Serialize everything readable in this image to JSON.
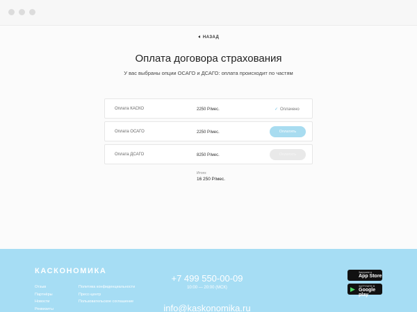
{
  "nav": {
    "back_label": "НАЗАД"
  },
  "header": {
    "title": "Оплата договора страхования",
    "subtitle": "У вас выбраны опции ОСАГО и ДСАГО: оплата происходит по частям"
  },
  "payments": [
    {
      "name": "Оплата КАСКО",
      "price": "2250 Р/мес.",
      "status": "Оплачено"
    },
    {
      "name": "Оплата ОСАГО",
      "price": "2250 Р/мес.",
      "button": "Оплатить"
    },
    {
      "name": "Оплата ДСАГО",
      "price": "8250 Р/мес.",
      "button": "Оплатить"
    }
  ],
  "total": {
    "label": "Итого:",
    "value": "16 250 Р/мес."
  },
  "footer": {
    "logo": "КАСКОНОМИКА",
    "links_col1": [
      "Отзыв",
      "Партнёры",
      "Новости",
      "Реквизиты"
    ],
    "links_col2": [
      "Политика конфиденциальности",
      "Пресс-центр",
      "Пользовательское соглашение"
    ],
    "phone": "+7 499 550-00-09",
    "hours": "10:00 — 20:00 (МСК)",
    "email": "info@kaskonomika.ru",
    "appstore_small": "Загрузите в",
    "appstore_big": "App Store",
    "googleplay_small": "ЗАГРУЗИТЕ В",
    "googleplay_big": "Google play"
  },
  "colors": {
    "accent": "#a6ddf4",
    "button": "#a8dcf0",
    "disabled": "#e9e9e9"
  }
}
